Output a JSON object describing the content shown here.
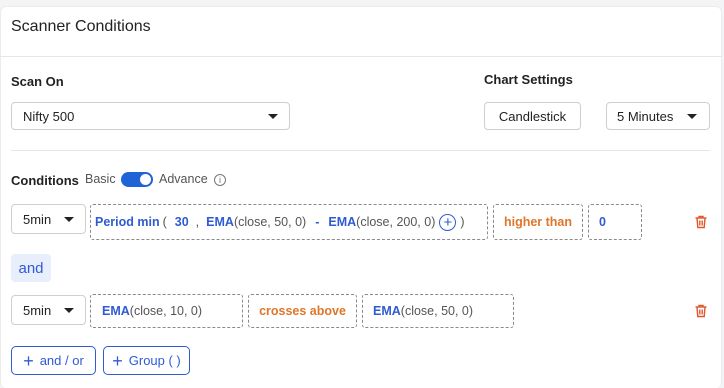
{
  "header": {
    "title": "Scanner Conditions"
  },
  "scan_on": {
    "label": "Scan On",
    "value": "Nifty 500"
  },
  "chart_settings": {
    "label": "Chart Settings",
    "chart_type": "Candlestick",
    "timeframe": "5 Minutes"
  },
  "conditions": {
    "label": "Conditions",
    "mode_basic": "Basic",
    "mode_advance": "Advance",
    "info_glyph": "i",
    "rows": [
      {
        "timeframe": "5min",
        "expr1": {
          "fn": "Period min",
          "open": "(",
          "num": "30",
          "comma": ",",
          "fn2": "EMA",
          "args2": "(close, 50, 0)",
          "minus": "-",
          "fn3": "EMA",
          "args3": "(close, 200, 0)",
          "close": ")"
        },
        "operator": "higher than",
        "value": "0"
      },
      {
        "timeframe": "5min",
        "expr1": {
          "fn": "EMA",
          "args": "(close, 10, 0)"
        },
        "operator": "crosses above",
        "expr2": {
          "fn": "EMA",
          "args": "(close, 50, 0)"
        }
      }
    ],
    "joiner": "and"
  },
  "actions": {
    "and_or": "and / or",
    "group": "Group ( )",
    "plus": "+"
  },
  "colors": {
    "accent": "#2f5bd3",
    "operator": "#e0762a",
    "delete": "#e0552a"
  }
}
